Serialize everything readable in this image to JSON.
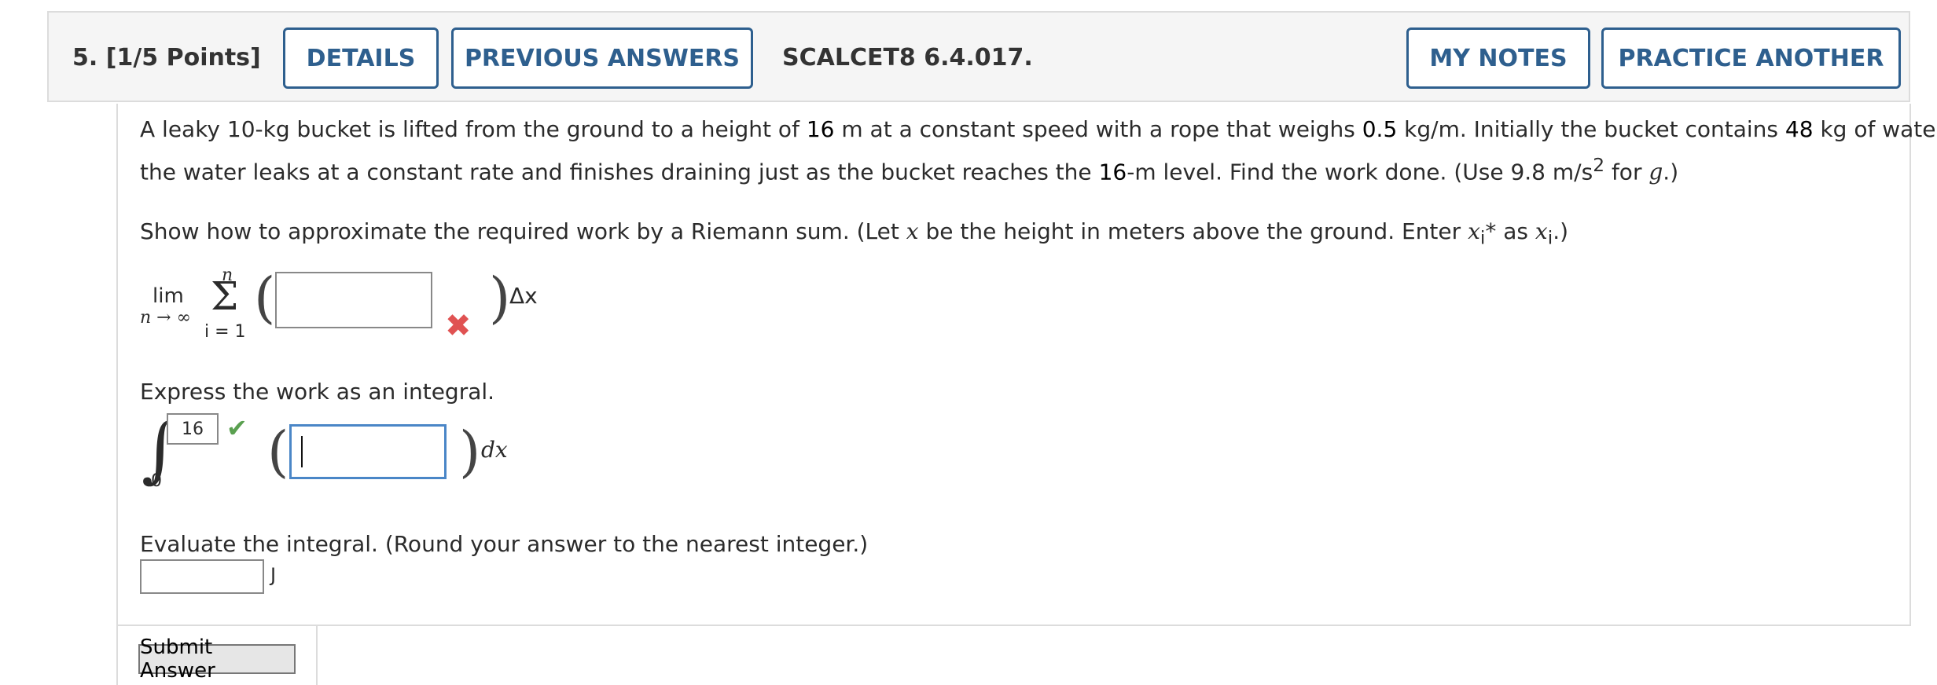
{
  "header": {
    "question_number": "5.",
    "points": "[1/5 Points]",
    "details_label": "DETAILS",
    "previous_answers_label": "PREVIOUS ANSWERS",
    "source_code": "SCALCET8 6.4.017.",
    "my_notes_label": "MY NOTES",
    "practice_another_label": "PRACTICE ANOTHER"
  },
  "problem": {
    "line1_a": "A leaky 10-kg bucket is lifted from the ground to a height of",
    "line1_height": "16",
    "line1_b": "m at a constant speed with a rope that weighs",
    "line1_rope": "0.5",
    "line1_c": "kg/m. Initially the bucket contains",
    "line1_water": "48",
    "line1_d": "kg of water, but",
    "line2_a": "the water leaks at a constant rate and finishes draining just as the bucket reaches the",
    "line2_level": "16",
    "line2_b": "-m level. Find the work done. (Use 9.8 m/s",
    "line2_exp": "2",
    "line2_c": "for",
    "line2_g": "g",
    "line2_d": ".)"
  },
  "part1": {
    "prompt_a": "Show how to approximate the required work by a Riemann sum. (Let",
    "prompt_x": "x",
    "prompt_b": "be the height in meters above the ground. Enter",
    "prompt_xi": "x",
    "prompt_i": "i",
    "prompt_star": "*",
    "prompt_as": "as",
    "prompt_xi2": "x",
    "prompt_i2": "i",
    "prompt_end": ".)",
    "lim": "lim",
    "lim_sub": "n → ∞",
    "sum_upper": "n",
    "sum_symbol": "Σ",
    "sum_lower": "i = 1",
    "delta": "Δx",
    "status": "incorrect",
    "status_color": "#e05252"
  },
  "part2": {
    "prompt": "Express the work as an integral.",
    "upper_limit": "16",
    "lower_limit": "0",
    "integral_symbol": "∫",
    "dx": "dx",
    "status": "correct",
    "status_color": "#5aa050"
  },
  "part3": {
    "prompt": "Evaluate the integral. (Round your answer to the nearest integer.)",
    "unit": "J"
  },
  "submit_label": "Submit Answer"
}
